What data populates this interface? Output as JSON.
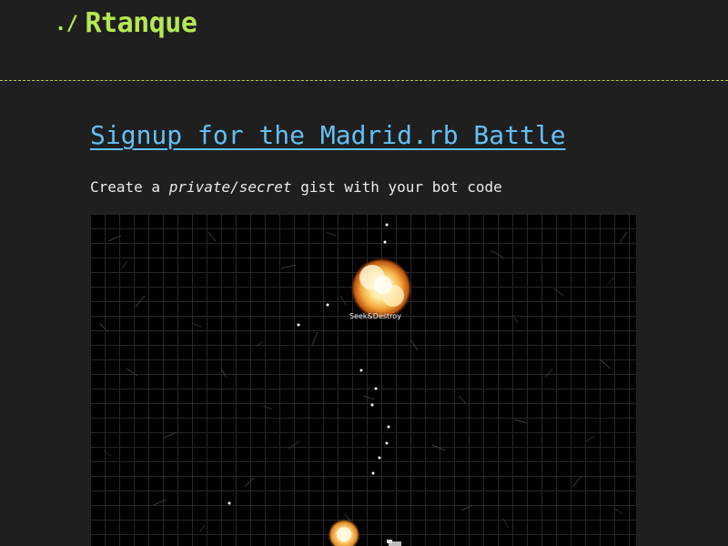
{
  "header": {
    "prompt": "./",
    "site_name": "Rtanque"
  },
  "main": {
    "title": "Signup for the Madrid.rb Battle",
    "intro_before": "Create a ",
    "intro_emphasis": "private/secret",
    "intro_after": " gist with your bot code"
  },
  "arena": {
    "bot_label": "Seek&Destroy",
    "colors": {
      "background": "#000000",
      "grid": "#262626",
      "explosion_core": "#fff8c8",
      "explosion_outer": "#d36a12",
      "bullet": "#ffffff"
    }
  },
  "colors": {
    "page_background": "#1f1f1f",
    "brand": "#b5e853",
    "link": "#63c0f5",
    "text": "#eaeaea"
  }
}
